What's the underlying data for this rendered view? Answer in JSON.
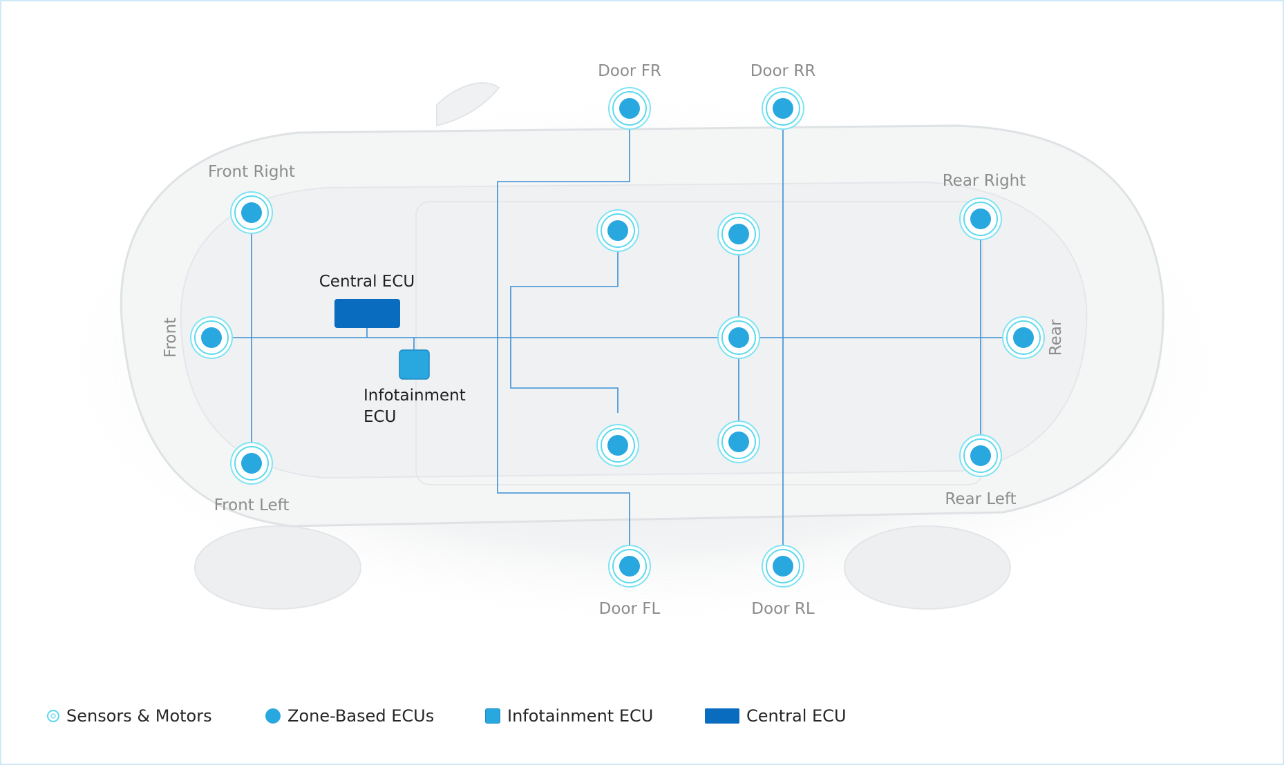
{
  "diagram": {
    "orientation": {
      "front": "Front",
      "rear": "Rear"
    },
    "central_ecu": "Central ECU",
    "infotainment_ecu": [
      "Infotainment",
      "ECU"
    ],
    "zones": {
      "front_right": "Front Right",
      "front_left": "Front Left",
      "rear_right": "Rear Right",
      "rear_left": "Rear Left",
      "door_fr": "Door FR",
      "door_rr": "Door RR",
      "door_fl": "Door FL",
      "door_rl": "Door RL"
    }
  },
  "legend": {
    "sensors": "Sensors & Motors",
    "zone_ecus": "Zone-Based ECUs",
    "infotainment": "Infotainment ECU",
    "central": "Central ECU"
  },
  "colors": {
    "line": "#3a8fd3",
    "zone_node": "#29a8e0",
    "sensor_ring": "#5ad8ee",
    "central_ecu": "#0a6cbf",
    "infotainment_ecu": "#29a8e0"
  }
}
